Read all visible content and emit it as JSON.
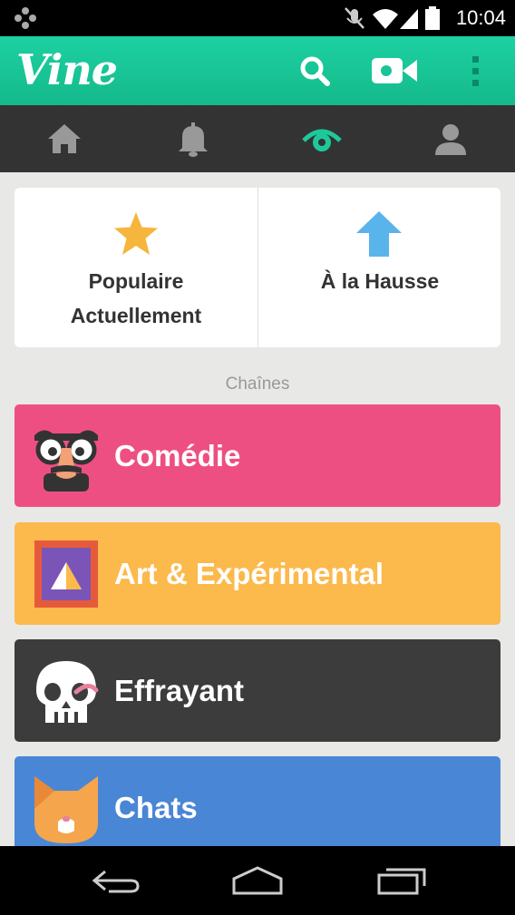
{
  "status_bar": {
    "time": "10:04"
  },
  "app_bar": {
    "logo": "Vine",
    "icons": [
      "search-icon",
      "video-camera-icon",
      "overflow-menu-icon"
    ]
  },
  "nav_tabs": [
    {
      "name": "home",
      "icon": "home-icon"
    },
    {
      "name": "notifications",
      "icon": "bell-icon"
    },
    {
      "name": "explore",
      "icon": "eye-icon",
      "active": true
    },
    {
      "name": "profile",
      "icon": "profile-icon"
    }
  ],
  "featured": {
    "popular_line1": "Populaire",
    "popular_line2": "Actuellement",
    "trending": "À la Hausse"
  },
  "section_title": "Chaînes",
  "channels": [
    {
      "label": "Comédie",
      "color": "#ee4f82",
      "icon": "comedy-mask-icon"
    },
    {
      "label": "Art & Expérimental",
      "color": "#fcb94c",
      "icon": "art-frame-icon"
    },
    {
      "label": "Effrayant",
      "color": "#3c3c3c",
      "icon": "skull-icon"
    },
    {
      "label": "Chats",
      "color": "#4a86d6",
      "icon": "cat-icon"
    }
  ],
  "colors": {
    "accent": "#1dc99a",
    "star": "#f6b53c",
    "arrow": "#5ab4ec"
  }
}
